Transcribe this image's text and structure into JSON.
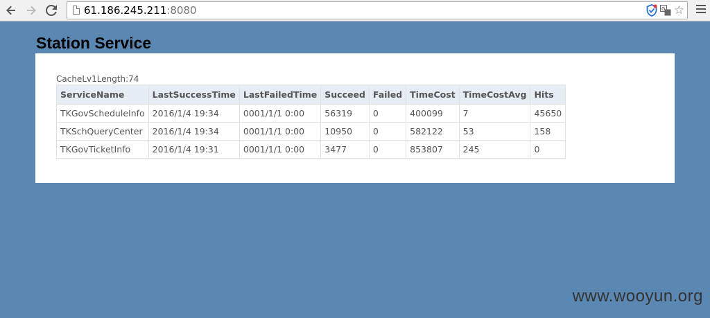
{
  "browser": {
    "url_host": "61.186.245.211",
    "url_port": ":8080"
  },
  "page": {
    "title": "Station Service",
    "cache_label": "CacheLv1Length:74"
  },
  "table": {
    "columns": [
      "ServiceName",
      "LastSuccessTime",
      "LastFailedTime",
      "Succeed",
      "Failed",
      "TimeCost",
      "TimeCostAvg",
      "Hits"
    ],
    "rows": [
      [
        "TKGovScheduleInfo",
        "2016/1/4 19:34",
        "0001/1/1 0:00",
        "56319",
        "0",
        "400099",
        "7",
        "45650"
      ],
      [
        "TKSchQueryCenter",
        "2016/1/4 19:34",
        "0001/1/1 0:00",
        "10950",
        "0",
        "582122",
        "53",
        "158"
      ],
      [
        "TKGovTicketInfo",
        "2016/1/4 19:31",
        "0001/1/1 0:00",
        "3477",
        "0",
        "853807",
        "245",
        "0"
      ]
    ]
  },
  "watermark": "www.wooyun.org",
  "icons": {
    "back": "back-arrow-icon",
    "forward": "forward-arrow-icon",
    "reload": "reload-icon",
    "page": "page-icon",
    "shield": "shield-icon",
    "translate": "translate-icon",
    "star": "star-icon",
    "menu": "menu-icon"
  },
  "colors": {
    "page_background": "#5b87b3",
    "table_header": "#e7edf5"
  }
}
